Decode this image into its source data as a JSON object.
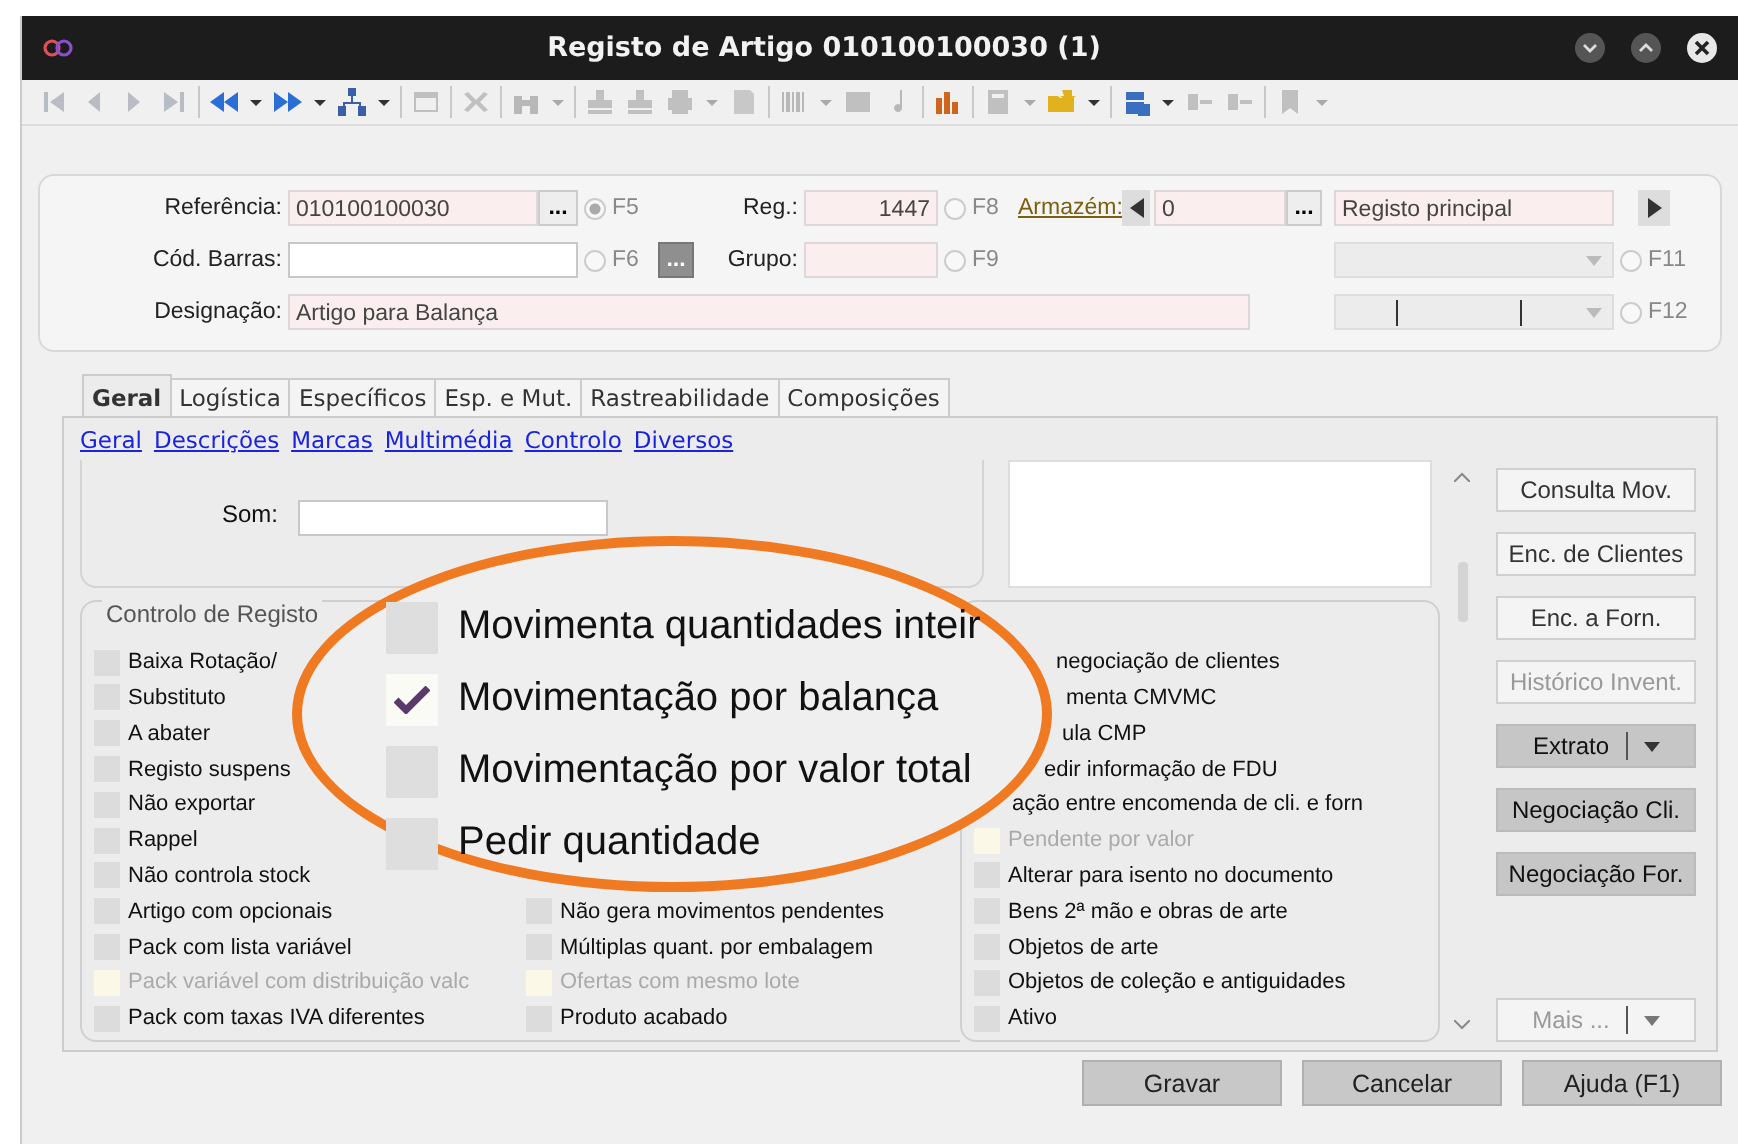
{
  "window": {
    "title": "Registo de Artigo 010100100030 (1)"
  },
  "header": {
    "referencia": {
      "label": "Referência:",
      "value": "010100100030",
      "button": "...",
      "radio": {
        "label": "F5",
        "selected": true
      }
    },
    "reg": {
      "label": "Reg.:",
      "value": "1447",
      "radio": {
        "label": "F8",
        "selected": false
      }
    },
    "armazem": {
      "label": "Armazém:",
      "value": "0",
      "button": "...",
      "name": "Registo principal"
    },
    "cod_barras": {
      "label": "Cód. Barras:",
      "radio": {
        "label": "F6",
        "selected": false
      },
      "button": "..."
    },
    "grupo": {
      "label": "Grupo:",
      "radio": {
        "label": "F9",
        "selected": false
      }
    },
    "dropdown_1": {
      "radio": {
        "label": "F11",
        "selected": false
      }
    },
    "designacao": {
      "label": "Designação:",
      "value": "Artigo para Balança"
    },
    "dropdown_2": {
      "radio": {
        "label": "F12",
        "selected": false
      }
    }
  },
  "tabs": [
    {
      "label": "Geral",
      "selected": true
    },
    {
      "label": "Logística",
      "selected": false
    },
    {
      "label": "Específicos",
      "selected": false
    },
    {
      "label": "Esp. e Mut.",
      "selected": false
    },
    {
      "label": "Rastreabilidade",
      "selected": false
    },
    {
      "label": "Composições",
      "selected": false
    }
  ],
  "sub_links": [
    "Geral",
    "Descrições",
    "Marcas",
    "Multimédia",
    "Controlo",
    "Diversos"
  ],
  "upper": {
    "som_label": "Som:"
  },
  "side_buttons": [
    {
      "label": "Consulta Mov.",
      "emphasized": false,
      "disabled": false,
      "split": false
    },
    {
      "label": "Enc. de Clientes",
      "emphasized": false,
      "disabled": false,
      "split": false
    },
    {
      "label": "Enc. a Forn.",
      "emphasized": false,
      "disabled": false,
      "split": false
    },
    {
      "label": "Histórico Invent.",
      "emphasized": false,
      "disabled": true,
      "split": false
    },
    {
      "label": "Extrato",
      "emphasized": true,
      "disabled": false,
      "split": true
    },
    {
      "label": "Negociação Cli.",
      "emphasized": true,
      "disabled": false,
      "split": false
    },
    {
      "label": "Negociação For.",
      "emphasized": true,
      "disabled": false,
      "split": false
    }
  ],
  "more_button": {
    "label": "Mais ...",
    "disabled": true,
    "split": true
  },
  "groups": [
    {
      "title": "Controlo de Registo",
      "columns": [
        [
          {
            "label": "Baixa Rotação/",
            "checked": false,
            "disabled": false,
            "kind": "normal"
          },
          {
            "label": "Substituto",
            "checked": false,
            "disabled": false,
            "kind": "normal"
          },
          {
            "label": "A abater",
            "checked": false,
            "disabled": false,
            "kind": "normal"
          },
          {
            "label": "Registo suspens",
            "checked": false,
            "disabled": false,
            "kind": "normal"
          },
          {
            "label": "Não exportar",
            "checked": false,
            "disabled": false,
            "kind": "normal"
          },
          {
            "label": "Rappel",
            "checked": false,
            "disabled": false,
            "kind": "normal"
          },
          {
            "label": "Não controla stock",
            "checked": false,
            "disabled": false,
            "kind": "normal"
          },
          {
            "label": "Artigo com opcionais",
            "checked": false,
            "disabled": false,
            "kind": "normal"
          },
          {
            "label": "Pack com lista variável",
            "checked": false,
            "disabled": false,
            "kind": "normal"
          },
          {
            "label": "Pack variável com distribuição valc",
            "checked": false,
            "disabled": true,
            "kind": "normal"
          },
          {
            "label": "Pack com taxas IVA diferentes",
            "checked": false,
            "disabled": false,
            "kind": "normal"
          }
        ],
        [
          {
            "label": "Não gera movimentos pendentes",
            "checked": false,
            "disabled": false,
            "kind": "normal"
          },
          {
            "label": "Múltiplas quant. por embalagem",
            "checked": false,
            "disabled": false,
            "kind": "normal"
          },
          {
            "label": "Ofertas com mesmo lote",
            "checked": false,
            "disabled": true,
            "kind": "normal"
          },
          {
            "label": "Produto acabado",
            "checked": false,
            "disabled": false,
            "kind": "normal"
          }
        ]
      ]
    },
    {
      "columns": [
        [
          {
            "label": "negociação de clientes",
            "kind": "covered"
          },
          {
            "label": "menta CMVMC",
            "kind": "covered"
          },
          {
            "label": "ula CMP",
            "kind": "covered"
          },
          {
            "label": "edir informação de FDU",
            "kind": "covered"
          },
          {
            "label": "ação entre encomenda de cli. e forn",
            "kind": "covered"
          },
          {
            "label": "Pendente por valor",
            "checked": false,
            "disabled": true,
            "kind": "normal"
          },
          {
            "label": "Alterar para isento no documento",
            "checked": false,
            "disabled": false,
            "kind": "normal"
          },
          {
            "label": "Bens 2ª mão e obras de arte",
            "checked": false,
            "disabled": false,
            "kind": "normal"
          },
          {
            "label": "Objetos de arte",
            "checked": false,
            "disabled": false,
            "kind": "normal"
          },
          {
            "label": "Objetos de coleção e antiguidades",
            "checked": false,
            "disabled": false,
            "kind": "normal"
          },
          {
            "label": "Ativo",
            "checked": false,
            "disabled": false,
            "kind": "normal"
          }
        ]
      ]
    }
  ],
  "magnifier": {
    "items": [
      {
        "label": "Movimenta quantidades inteir",
        "checked": false
      },
      {
        "label": "Movimentação por balança",
        "checked": true
      },
      {
        "label": "Movimentação por valor total",
        "checked": false
      },
      {
        "label": "Pedir quantidade",
        "checked": false
      }
    ]
  },
  "footer_buttons": [
    "Gravar",
    "Cancelar",
    "Ajuda (F1)"
  ]
}
